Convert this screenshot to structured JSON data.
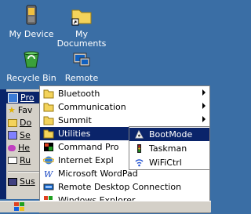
{
  "desktop": {
    "icons": [
      {
        "label": "My Device",
        "icon": "device-icon"
      },
      {
        "label": "My Documents",
        "icon": "folder-icon"
      },
      {
        "label": "Recycle Bin",
        "icon": "recycle-bin-icon"
      },
      {
        "label": "Remote",
        "icon": "remote-icon"
      }
    ]
  },
  "start_menu": {
    "items": [
      {
        "label": "Programs",
        "icon": "programs-icon"
      },
      {
        "label": "Favorites",
        "icon": "favorites-icon"
      },
      {
        "label": "Documents",
        "icon": "documents-icon"
      },
      {
        "label": "Settings",
        "icon": "settings-icon"
      },
      {
        "label": "Help",
        "icon": "help-icon"
      },
      {
        "label": "Run",
        "icon": "run-icon"
      },
      {
        "label": "Suspend",
        "icon": "suspend-icon"
      }
    ],
    "visible_labels": [
      "Pro",
      "Fav",
      "Do",
      "Se",
      "He",
      "Ru",
      "Sus"
    ]
  },
  "programs_menu": {
    "items": [
      {
        "label": "Bluetooth",
        "icon": "folder-icon",
        "submenu": true
      },
      {
        "label": "Communication",
        "icon": "folder-icon",
        "submenu": true
      },
      {
        "label": "Summit",
        "icon": "folder-icon",
        "submenu": true
      },
      {
        "label": "Utilities",
        "icon": "folder-icon",
        "submenu": true,
        "selected": true
      },
      {
        "label": "Command Pro",
        "icon": "command-prompt-icon"
      },
      {
        "label": "Internet Expl",
        "icon": "internet-explorer-icon"
      },
      {
        "label": "Microsoft WordPad",
        "icon": "wordpad-icon"
      },
      {
        "label": "Remote Desktop Connection",
        "icon": "remote-desktop-icon"
      },
      {
        "label": "Windows Explorer",
        "icon": "windows-explorer-icon"
      }
    ]
  },
  "utilities_menu": {
    "items": [
      {
        "label": "BootMode",
        "icon": "bootmode-icon",
        "selected": true
      },
      {
        "label": "Taskman",
        "icon": "taskman-icon"
      },
      {
        "label": "WiFiCtrl",
        "icon": "wifictrl-icon"
      }
    ]
  },
  "colors": {
    "desktop_bg": "#3a6ea5",
    "menu_highlight": "#0a246a",
    "menu_bg": "#ffffff",
    "taskbar_bg": "#d4d0c8"
  }
}
